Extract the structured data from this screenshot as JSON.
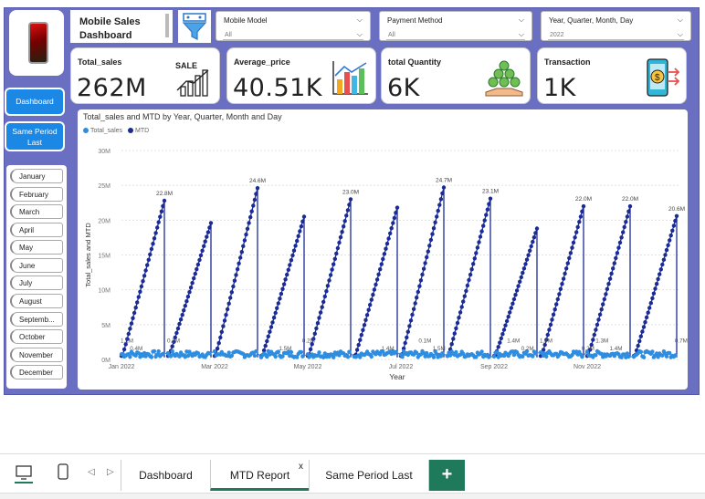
{
  "header": {
    "title": "Mobile Sales Dashboard"
  },
  "slicers": [
    {
      "label": "Mobile Model",
      "value": "All"
    },
    {
      "label": "Payment Method",
      "value": "All"
    },
    {
      "label": "Year, Quarter, Month, Day",
      "value": "2022"
    }
  ],
  "kpis": [
    {
      "label": "Total_sales",
      "value": "262M",
      "icon": "sale-chart-icon"
    },
    {
      "label": "Average_price",
      "value": "40.51K",
      "icon": "bar-chart-icon"
    },
    {
      "label": "total Quantity",
      "value": "6K",
      "icon": "money-hand-icon"
    },
    {
      "label": "Transaction",
      "value": "1K",
      "icon": "mobile-payment-icon"
    }
  ],
  "nav": {
    "dashboard": "Dashboard",
    "same_period": "Same Period Last"
  },
  "months": [
    "January",
    "February",
    "March",
    "April",
    "May",
    "June",
    "July",
    "August",
    "Septemb...",
    "October",
    "November",
    "December"
  ],
  "chart_data": {
    "type": "line",
    "title": "Total_sales and MTD by Year, Quarter, Month and Day",
    "xlabel": "Year",
    "ylabel": "Total_sales and MTD",
    "ylim": [
      0,
      30000000
    ],
    "yticks": [
      "0M",
      "5M",
      "10M",
      "15M",
      "20M",
      "25M",
      "30M"
    ],
    "xticks": [
      "Jan 2022",
      "Mar 2022",
      "May 2022",
      "Jul 2022",
      "Sep 2022",
      "Nov 2022"
    ],
    "series": [
      {
        "name": "Total_sales",
        "color": "#2e8de0"
      },
      {
        "name": "MTD",
        "color": "#1a2b96"
      }
    ],
    "months": [
      {
        "month": "Jan",
        "mtd_end": 22.8,
        "label": "22.8M"
      },
      {
        "month": "Feb",
        "mtd_end": 19.6,
        "label": ""
      },
      {
        "month": "Mar",
        "mtd_end": 24.6,
        "label": "24.6M"
      },
      {
        "month": "Apr",
        "mtd_end": 20.5,
        "label": ""
      },
      {
        "month": "May",
        "mtd_end": 23.0,
        "label": "23.0M"
      },
      {
        "month": "Jun",
        "mtd_end": 21.8,
        "label": ""
      },
      {
        "month": "Jul",
        "mtd_end": 24.7,
        "label": "24.7M"
      },
      {
        "month": "Aug",
        "mtd_end": 23.1,
        "label": "23.1M"
      },
      {
        "month": "Sep",
        "mtd_end": 18.8,
        "label": ""
      },
      {
        "month": "Oct",
        "mtd_end": 22.0,
        "label": "22.0M"
      },
      {
        "month": "Nov",
        "mtd_end": 22.0,
        "label": "22.0M"
      },
      {
        "month": "Dec",
        "mtd_end": 20.6,
        "label": "20.6M"
      }
    ],
    "small_labels": [
      "1.1M",
      "0.4M",
      "0.2M",
      "1.5M",
      "0.2M",
      "1.4M",
      "0.1M",
      "1.5M",
      "1.4M",
      "0.2M",
      "1.4M",
      "0.2M",
      "1.3M",
      "1.4M",
      "0.7M"
    ]
  },
  "tabs": {
    "dashboard": "Dashboard",
    "mtd": "MTD Report",
    "close": "x",
    "same_period": "Same Period Last",
    "add": "+"
  }
}
